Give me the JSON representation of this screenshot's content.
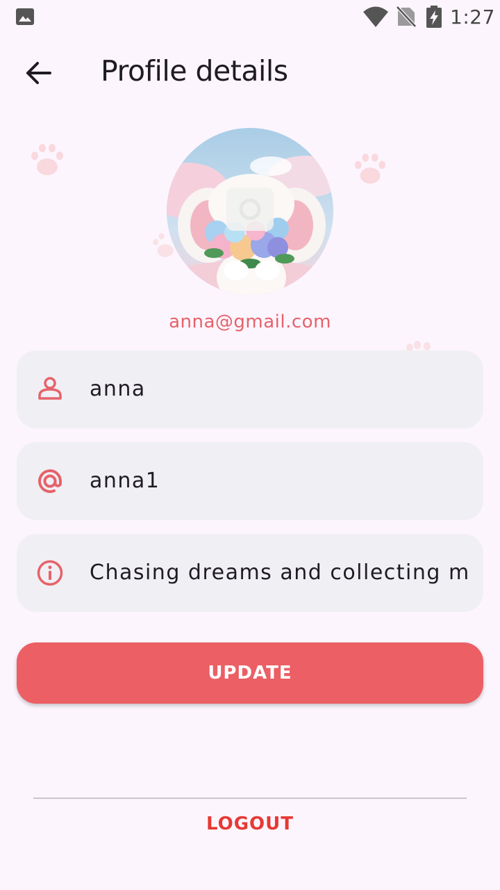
{
  "status_bar": {
    "time": "1:27",
    "icons": [
      "gallery-icon",
      "wifi-icon",
      "no-sim-icon",
      "battery-charging-icon"
    ]
  },
  "app_bar": {
    "title": "Profile details",
    "back_icon": "arrow-left-icon"
  },
  "profile": {
    "email": "anna@gmail.com",
    "avatar_overlay_icon": "camera-icon"
  },
  "fields": {
    "name": {
      "value": "anna",
      "icon": "person-icon"
    },
    "username": {
      "value": "anna1",
      "icon": "at-icon"
    },
    "bio": {
      "value": "Chasing dreams and collecting memories",
      "icon": "info-icon"
    }
  },
  "actions": {
    "update_label": "UPDATE",
    "logout_label": "LOGOUT"
  },
  "colors": {
    "accent": "#eb5f65",
    "logout": "#e53935",
    "background": "#fcf5fd",
    "field_bg": "#f0eff4",
    "icon": "#e6626a"
  }
}
